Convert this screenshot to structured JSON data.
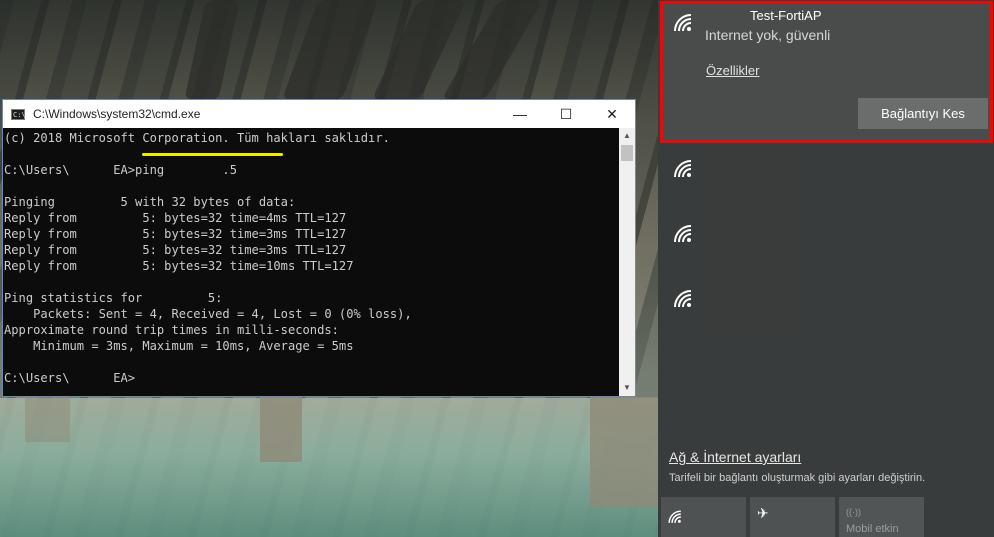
{
  "cmd": {
    "title": "C:\\Windows\\system32\\cmd.exe",
    "icon_text": "C:\\",
    "controls": {
      "minimize": "—",
      "maximize": "☐",
      "close": "✕"
    },
    "lines": [
      "(c) 2018 Microsoft Corporation. Tüm hakları saklıdır.",
      "",
      "C:\\Users\\      EA>ping        .5",
      "",
      "Pinging         5 with 32 bytes of data:",
      "Reply from         5: bytes=32 time=4ms TTL=127",
      "Reply from         5: bytes=32 time=3ms TTL=127",
      "Reply from         5: bytes=32 time=3ms TTL=127",
      "Reply from         5: bytes=32 time=10ms TTL=127",
      "",
      "Ping statistics for         5:",
      "    Packets: Sent = 4, Received = 4, Lost = 0 (0% loss),",
      "Approximate round trip times in milli-seconds:",
      "    Minimum = 3ms, Maximum = 10ms, Average = 5ms",
      "",
      "C:\\Users\\      EA>"
    ],
    "scroll_up": "▲",
    "scroll_down": "▼"
  },
  "network": {
    "connected": {
      "ssid": "Test-FortiAP",
      "status": "Internet yok, güvenli",
      "properties_link": "Özellikler",
      "disconnect_button": "Bağlantıyı Kes"
    },
    "settings_link": "Ağ & İnternet ayarları",
    "settings_description": "Tarifeli bir bağlantı oluşturmak gibi ayarları değiştirin.",
    "quick_actions": [
      {
        "label": "",
        "icon": "wifi-icon"
      },
      {
        "label": "",
        "icon": "airplane-icon",
        "glyph": "✈"
      },
      {
        "label": "Mobil etkin",
        "icon": "mobile-hotspot-icon",
        "glyph": "((·))"
      }
    ]
  },
  "colors": {
    "highlight_underline": "#f0ea00",
    "annotation_box": "#e20d0d",
    "cmd_text": "#cccccc",
    "flyout_bg": "#393c3c"
  }
}
